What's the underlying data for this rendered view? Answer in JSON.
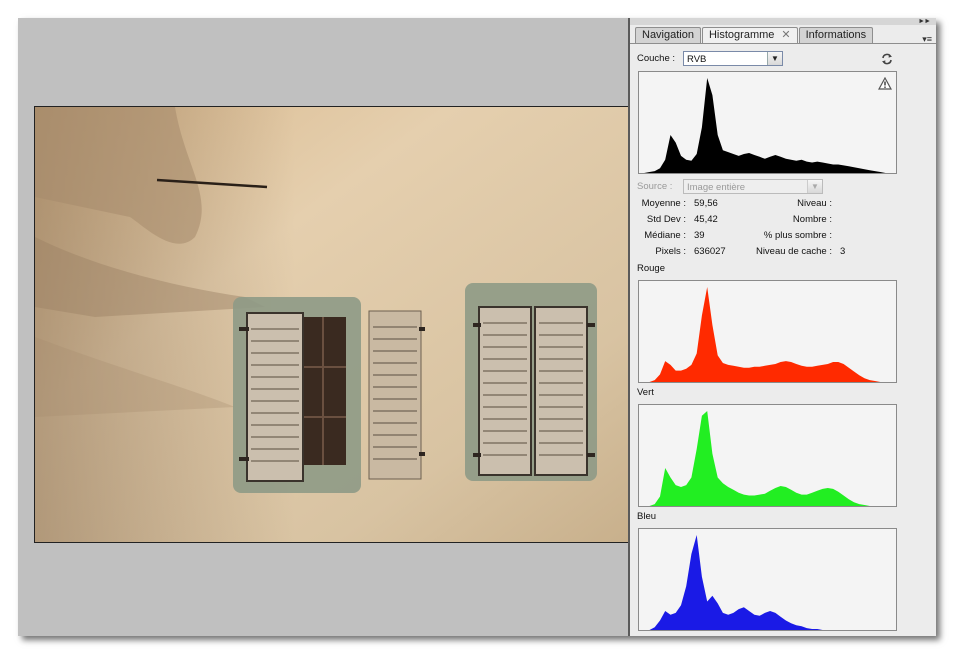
{
  "tabs": [
    {
      "label": "Navigation"
    },
    {
      "label": "Histogramme"
    },
    {
      "label": "Informations"
    }
  ],
  "channel": {
    "label": "Couche :",
    "value": "RVB"
  },
  "source": {
    "label": "Source :",
    "value": "Image entière"
  },
  "stats": {
    "mean_label": "Moyenne :",
    "mean": "59,56",
    "std_label": "Std Dev :",
    "std": "45,42",
    "median_label": "Médiane :",
    "median": "39",
    "pixels_label": "Pixels :",
    "pixels": "636027",
    "level_label": "Niveau :",
    "level": "",
    "count_label": "Nombre :",
    "count": "",
    "percentile_label": "% plus sombre :",
    "percentile": "",
    "cache_label": "Niveau de cache :",
    "cache": "3"
  },
  "channels": {
    "red_label": "Rouge",
    "green_label": "Vert",
    "blue_label": "Bleu"
  },
  "colors": {
    "rgb_hist": "#000000",
    "red_hist": "#ff2a00",
    "green_hist": "#22ee22",
    "blue_hist": "#1a1ae6",
    "panel_bg": "#ececec",
    "canvas_bg": "#c0c0c0"
  },
  "icons": {
    "refresh": "refresh-icon",
    "warning": "warning-icon",
    "close": "close-icon",
    "dropdown": "chevron-down-icon",
    "panel_menu": "panel-menu-icon",
    "collapse": "collapse-panel-icon"
  },
  "histograms": {
    "rgb": [
      0,
      0,
      1,
      2,
      5,
      14,
      40,
      32,
      18,
      14,
      13,
      20,
      48,
      100,
      82,
      40,
      24,
      22,
      20,
      18,
      20,
      21,
      19,
      17,
      15,
      17,
      19,
      17,
      15,
      14,
      13,
      14,
      12,
      11,
      12,
      11,
      10,
      9,
      9,
      8,
      7,
      6,
      5,
      4,
      3,
      2,
      1,
      0,
      0,
      0
    ],
    "red": [
      0,
      0,
      0,
      2,
      8,
      22,
      18,
      12,
      12,
      14,
      18,
      30,
      70,
      100,
      60,
      28,
      20,
      18,
      17,
      16,
      15,
      15,
      16,
      16,
      17,
      18,
      19,
      21,
      22,
      21,
      19,
      17,
      16,
      16,
      17,
      18,
      19,
      21,
      21,
      19,
      15,
      11,
      7,
      4,
      2,
      1,
      0,
      0,
      0,
      0
    ],
    "green": [
      0,
      0,
      0,
      2,
      10,
      40,
      30,
      22,
      20,
      22,
      30,
      60,
      95,
      100,
      55,
      30,
      24,
      20,
      17,
      14,
      12,
      11,
      11,
      12,
      13,
      16,
      19,
      21,
      20,
      17,
      14,
      12,
      12,
      14,
      16,
      18,
      19,
      18,
      15,
      11,
      7,
      4,
      2,
      1,
      0,
      0,
      0,
      0,
      0,
      0
    ],
    "blue": [
      0,
      0,
      0,
      3,
      10,
      20,
      16,
      18,
      26,
      46,
      80,
      100,
      56,
      30,
      36,
      28,
      18,
      16,
      18,
      22,
      24,
      20,
      16,
      15,
      18,
      20,
      18,
      14,
      10,
      7,
      5,
      4,
      2,
      1,
      1,
      0,
      0,
      0,
      0,
      0,
      0,
      0,
      0,
      0,
      0,
      0,
      0,
      0,
      0,
      0
    ]
  }
}
